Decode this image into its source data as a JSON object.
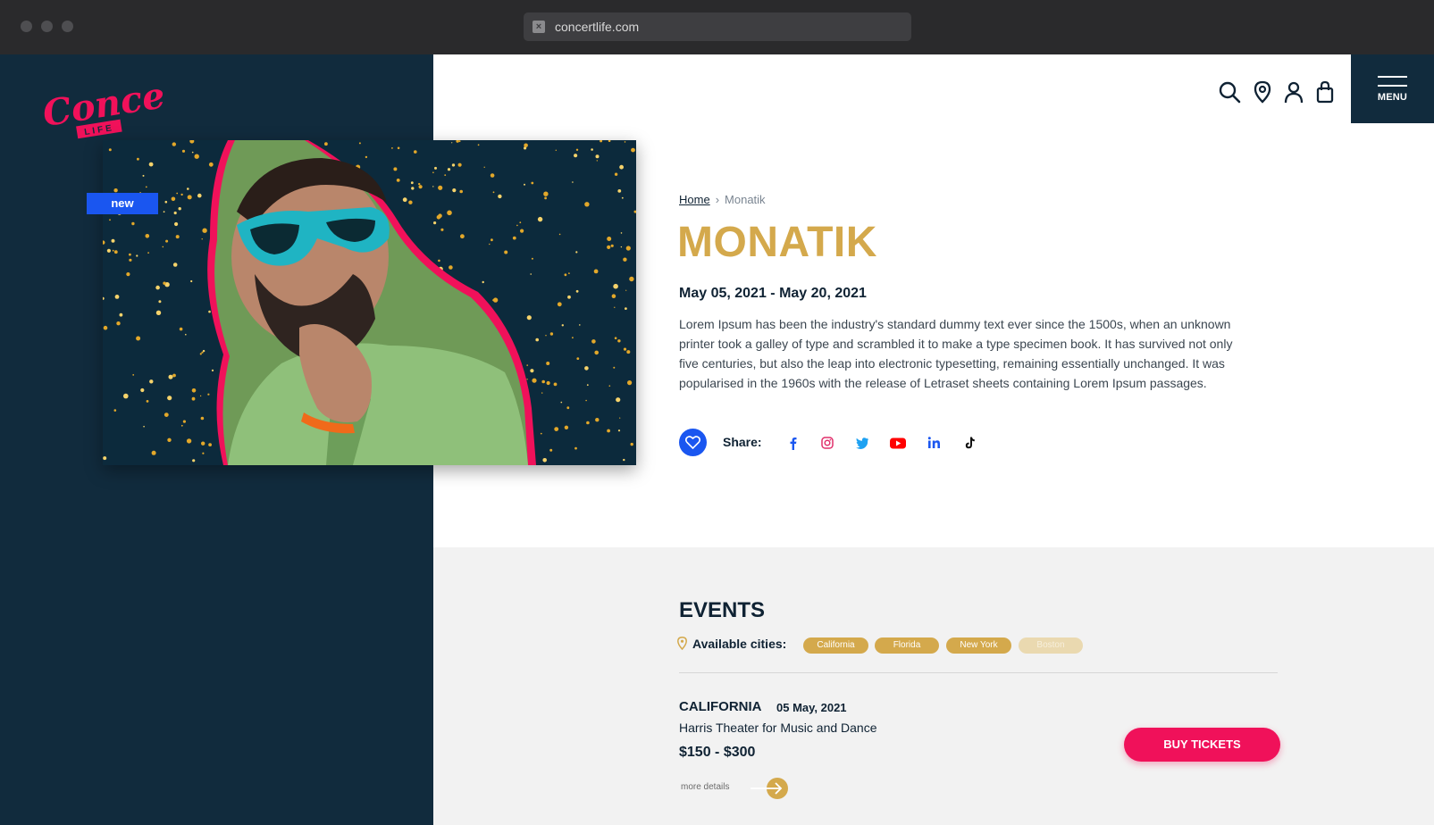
{
  "browser": {
    "url": "concertlife.com"
  },
  "brand": {
    "logo_text": "Concert",
    "logo_sub": "LIFE",
    "accent": "#f0115a",
    "dark": "#112b3d",
    "gold": "#d4a94c",
    "blue": "#1a56f0"
  },
  "hero": {
    "badge": "new"
  },
  "header": {
    "menu_label": "MENU",
    "icons": [
      "search-icon",
      "location-pin-icon",
      "user-icon",
      "shopping-bag-icon",
      "hamburger-icon"
    ]
  },
  "breadcrumb": {
    "home": "Home",
    "separator": "›",
    "current": "Monatik"
  },
  "artist": {
    "name": "MONATIK",
    "dates": "May 05, 2021 - May 20, 2021",
    "description": "Lorem Ipsum has been the industry's standard dummy text ever since the 1500s, when an unknown printer took a galley of type and scrambled it to make a type specimen book. It has survived not only five centuries, but also the leap into electronic typesetting, remaining essentially unchanged. It was popularised in the 1960s with the release of Letraset sheets containing Lorem Ipsum passages."
  },
  "share": {
    "label": "Share:",
    "networks": [
      "facebook-icon",
      "instagram-icon",
      "twitter-icon",
      "youtube-icon",
      "linkedin-icon",
      "tiktok-icon"
    ]
  },
  "events": {
    "title": "EVENTS",
    "cities_label": "Available cities:",
    "cities": [
      "California",
      "Florida",
      "New York",
      "Boston"
    ],
    "items": [
      {
        "city": "CALIFORNIA",
        "date": "05 May, 2021",
        "venue": "Harris Theater for Music and Dance",
        "price": "$150 - $300",
        "more": "more details",
        "buy": "BUY TICKETS"
      }
    ]
  }
}
